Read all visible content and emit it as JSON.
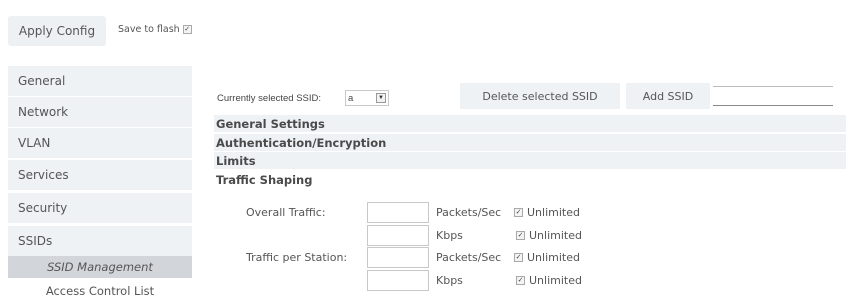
{
  "topbar": {
    "apply_label": "Apply Config",
    "save_label": "Save to flash",
    "save_checked": true
  },
  "sidebar": {
    "items": [
      {
        "label": "General"
      },
      {
        "label": "Network"
      },
      {
        "label": "VLAN"
      },
      {
        "label": "Services"
      },
      {
        "label": "Security"
      },
      {
        "label": "SSIDs"
      }
    ],
    "subitems": [
      {
        "label": "SSID Management",
        "active": true
      },
      {
        "label": "Access Control List",
        "active": false
      }
    ]
  },
  "ssid_bar": {
    "selected_label": "Currently selected SSID:",
    "selected_value": "a",
    "delete_label": "Delete selected SSID",
    "add_label": "Add SSID",
    "add_input_value": ""
  },
  "sections": {
    "general": "General Settings",
    "auth": "Authentication/Encryption",
    "limits": "Limits",
    "traffic": "Traffic Shaping"
  },
  "traffic": {
    "overall_label": "Overall Traffic:",
    "per_station_label": "Traffic per Station:",
    "packets_unit": "Packets/Sec",
    "kbps_unit": "Kbps",
    "unlimited_label": "Unlimited",
    "rows": [
      {
        "value": "",
        "unlimited": true
      },
      {
        "value": "",
        "unlimited": true
      },
      {
        "value": "",
        "unlimited": true
      },
      {
        "value": "",
        "unlimited": true
      }
    ]
  }
}
